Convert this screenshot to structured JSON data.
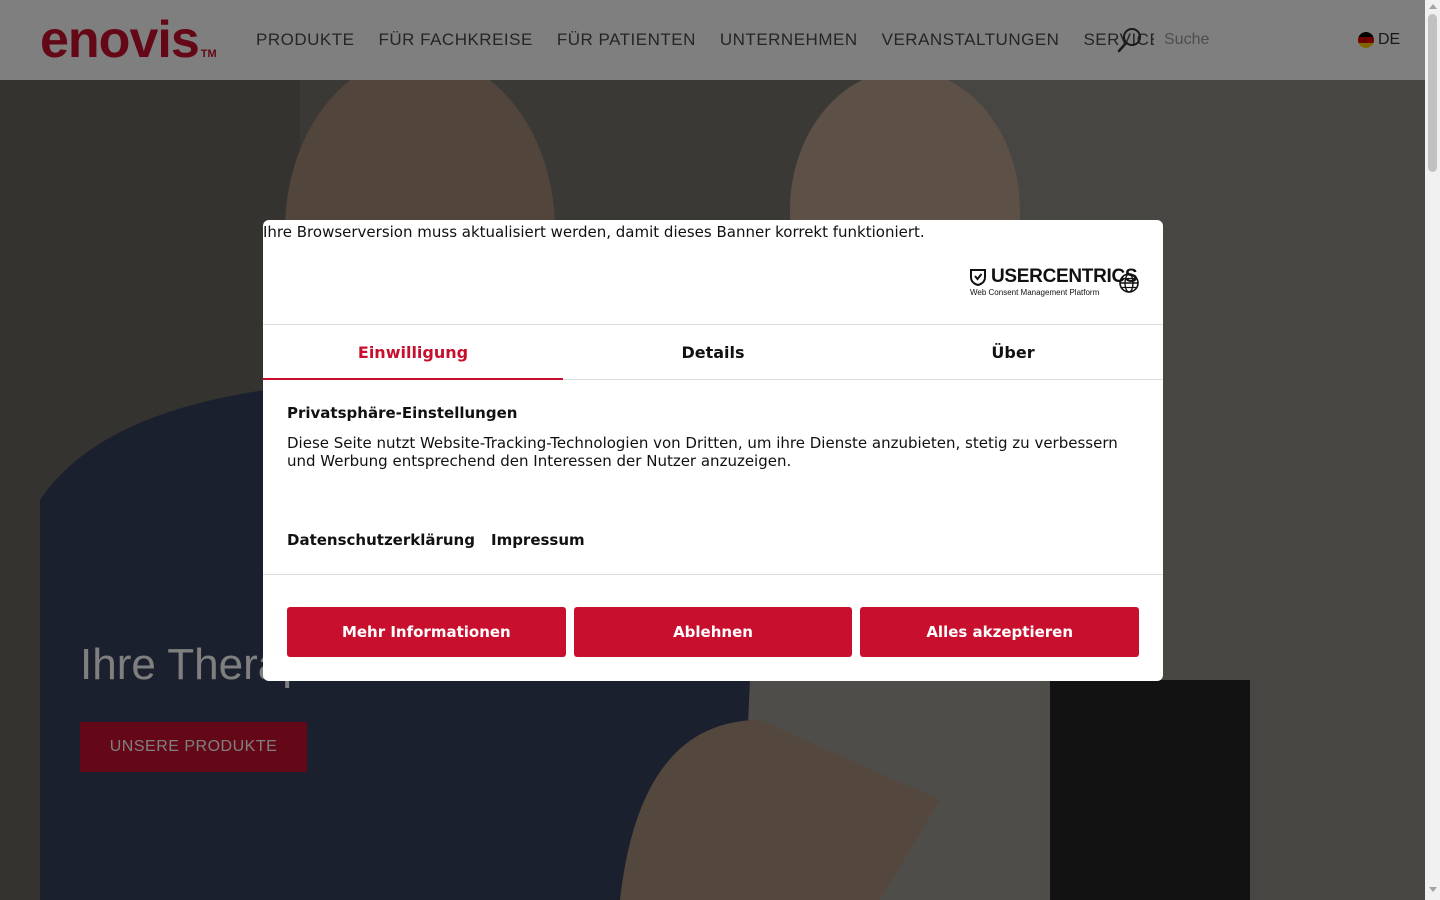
{
  "colors": {
    "brand": "#c8102e",
    "text": "#111111"
  },
  "header": {
    "logo_text": "enovis",
    "logo_tm": "TM",
    "nav": [
      "PRODUKTE",
      "FÜR FACHKREISE",
      "FÜR PATIENTEN",
      "UNTERNEHMEN",
      "VERANSTALTUNGEN",
      "SERVICE"
    ],
    "search_placeholder": "Suche",
    "language": "DE"
  },
  "hero": {
    "title": "Ihre Therap",
    "button": "UNSERE PRODUKTE"
  },
  "consent": {
    "browser_note": "Ihre Browserversion muss aktualisiert werden, damit dieses Banner korrekt funktioniert.",
    "brand": "USERCENTRICS",
    "brand_sub": "Web Consent Management Platform",
    "tabs": [
      "Einwilligung",
      "Details",
      "Über"
    ],
    "active_tab": "Einwilligung",
    "title": "Privatsphäre-Einstellungen",
    "text": "Diese Seite nutzt Website-Tracking-Technologien von Dritten, um ihre Dienste anzubieten, stetig zu verbessern und Werbung entsprechend den Interessen der Nutzer anzuzeigen.",
    "links": [
      "Datenschutzerklärung",
      "Impressum"
    ],
    "buttons": [
      "Mehr Informationen",
      "Ablehnen",
      "Alles akzeptieren"
    ]
  }
}
